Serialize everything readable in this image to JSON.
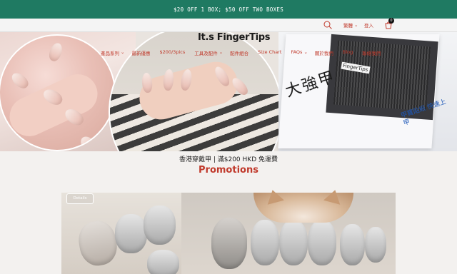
{
  "announcement": "$20 OFF 1 BOX; $50 OFF TWO BOXES",
  "header": {
    "language": "繁體",
    "login": "登入",
    "cart_count": "0",
    "logo": "It.s FingerTips"
  },
  "nav": {
    "items": [
      {
        "label": "產品系列"
      },
      {
        "label": "最新優惠"
      },
      {
        "label": "$200/3pics"
      },
      {
        "label": "工具及配件"
      },
      {
        "label": "配件組合"
      },
      {
        "label": "Size Chart"
      },
      {
        "label": "FAQs"
      },
      {
        "label": "關於我們"
      },
      {
        "label": "Blog"
      },
      {
        "label": "聯絡我們"
      }
    ]
  },
  "hero": {
    "box_text_zh": "大強甲",
    "box_brand": "FingerTips",
    "box_blue": "甲寶貼紙 快速上甲"
  },
  "tagline": "香港穿戴甲 | 滿$200 HKD 免運費",
  "section_title": "Promotions",
  "promo": {
    "details_label": "Details"
  },
  "colors": {
    "announcement_bg": "#1f7a62",
    "accent_red": "#c0392b"
  }
}
